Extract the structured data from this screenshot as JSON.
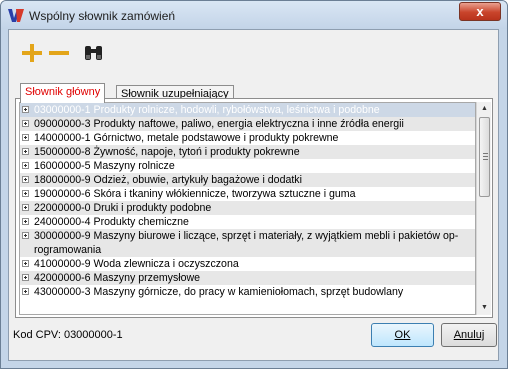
{
  "window": {
    "title": "Wspólny słownik zamówień",
    "close_label": "x"
  },
  "toolbar": {
    "add_icon": "plus-icon",
    "remove_icon": "minus-icon",
    "find_icon": "binoculars-icon"
  },
  "tabs": [
    {
      "label": "Słownik główny",
      "active": true
    },
    {
      "label": "Słownik uzupełniający",
      "active": false
    }
  ],
  "tree": [
    "03000000-1 Produkty rolnicze, hodowli, rybołówstwa, leśnictwa i podobne",
    "09000000-3 Produkty naftowe, paliwo, energia elektryczna i inne źródła energii",
    "14000000-1 Górnictwo, metale podstawowe i produkty pokrewne",
    "15000000-8 Żywność, napoje, tytoń i produkty pokrewne",
    "16000000-5 Maszyny rolnicze",
    "18000000-9 Odzież, obuwie, artykuły bagażowe i dodatki",
    "19000000-6 Skóra i tkaniny włókiennicze, tworzywa sztuczne i guma",
    "22000000-0 Druki i produkty podobne",
    "24000000-4 Produkty chemiczne",
    "30000000-9 Maszyny biurowe i liczące, sprzęt i materiały, z wyjątkiem mebli i pakietów op-",
    "rogramowania",
    "41000000-9 Woda zlewnicza i oczyszczona",
    "42000000-6 Maszyny przemysłowe",
    "43000000-3 Maszyny górnicze, do pracy w kamieniołomach, sprzęt budowlany"
  ],
  "status": {
    "text": "Kod CPV: 03000000-1"
  },
  "buttons": {
    "ok": "OK",
    "cancel": "Anuluj"
  }
}
